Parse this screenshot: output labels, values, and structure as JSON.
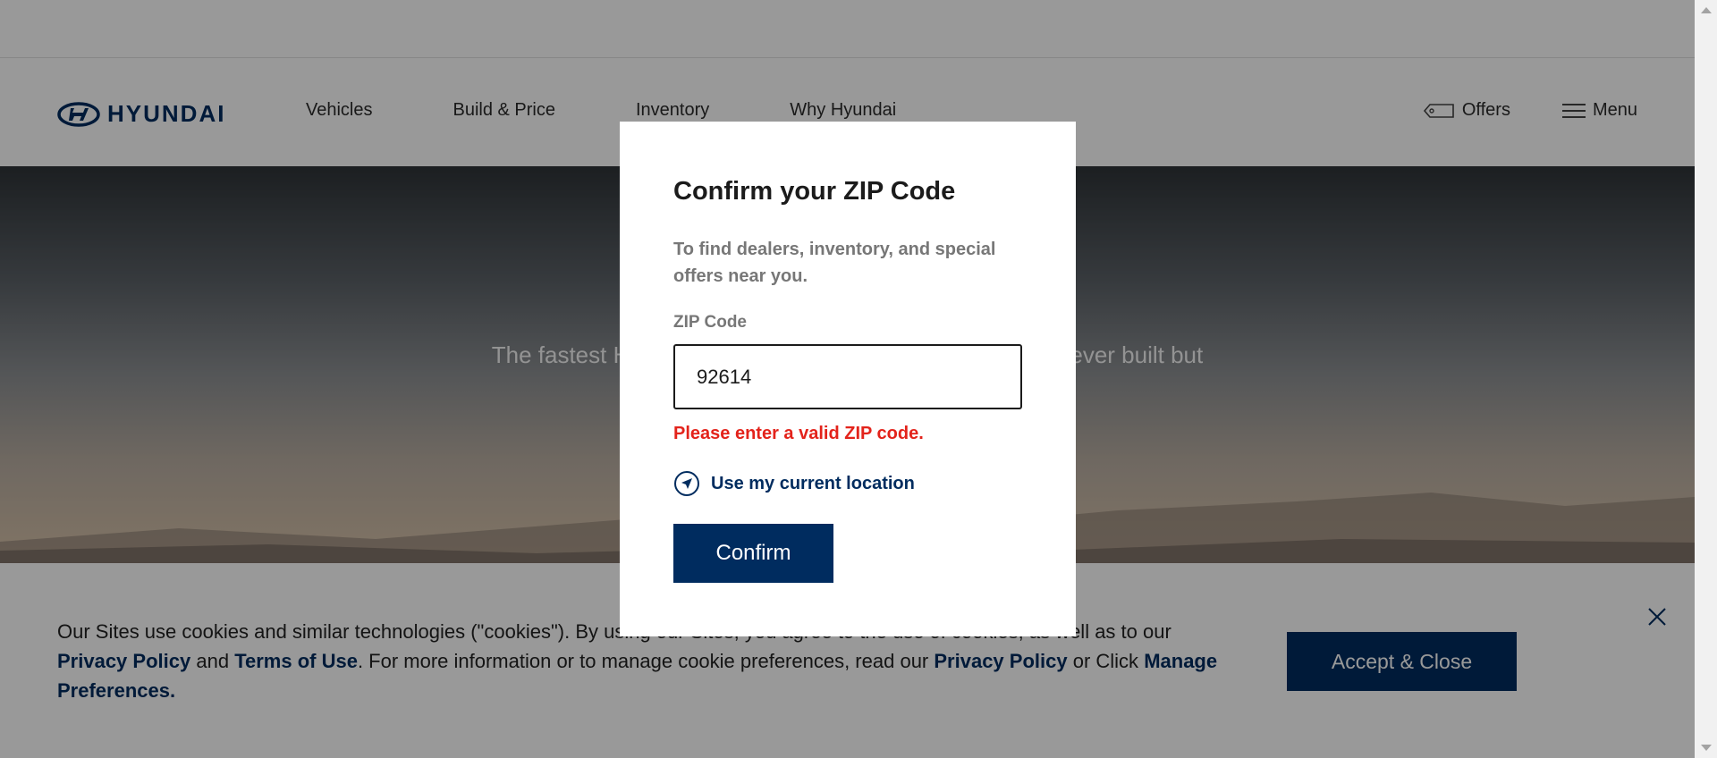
{
  "header": {
    "logo_text": "HYUNDAI",
    "nav": [
      "Vehicles",
      "Build & Price",
      "Inventory",
      "Why Hyundai"
    ],
    "offers_label": "Offers",
    "menu_label": "Menu"
  },
  "hero": {
    "text": "The fastest Hyundai yet is not only the fastest EV we've ever built but"
  },
  "cookie": {
    "text_1": "Our Sites use cookies and similar technologies (\"cookies\"). By using our Sites, you agree to the use of cookies, as well as to our",
    "privacy_link_1": "Privacy Policy",
    "and": "and",
    "terms_link": "Terms of Use",
    "text_2": ". For more information or to manage cookie preferences, read our",
    "privacy_link_2": "Privacy Policy",
    "or_click": "or Click",
    "manage_link": "Manage Preferences.",
    "accept_label": "Accept & Close"
  },
  "modal": {
    "title": "Confirm your ZIP Code",
    "description": "To find dealers, inventory, and special offers near you.",
    "zip_label": "ZIP Code",
    "zip_value": "92614",
    "error": "Please enter a valid ZIP code.",
    "location_label": "Use my current location",
    "confirm_label": "Confirm"
  },
  "colors": {
    "brand_navy": "#002c5f",
    "error_red": "#e3231b"
  },
  "icons": [
    "hyundai-logo-icon",
    "tag-icon",
    "hamburger-menu-icon",
    "close-icon",
    "location-arrow-icon"
  ]
}
